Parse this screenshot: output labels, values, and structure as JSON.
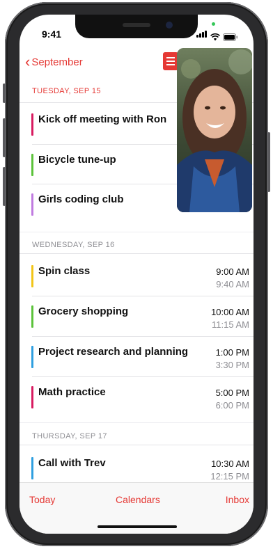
{
  "status_bar": {
    "time": "9:41"
  },
  "nav": {
    "back_label": "September"
  },
  "colors": {
    "accent": "#e53935",
    "section_today": "#e53935",
    "section_other": "#8e8e93"
  },
  "sections": [
    {
      "header": "TUESDAY, SEP 15",
      "events": [
        {
          "title": "Kick off meeting with Ron",
          "color": "#d81b60"
        },
        {
          "title": "Bicycle tune-up",
          "color": "#5cc33b"
        },
        {
          "title": "Girls coding club",
          "color": "#c07be0"
        }
      ]
    },
    {
      "header": "WEDNESDAY, SEP 16",
      "events": [
        {
          "title": "Spin class",
          "start": "9:00 AM",
          "end": "9:40 AM",
          "color": "#f2c518"
        },
        {
          "title": "Grocery shopping",
          "start": "10:00 AM",
          "end": "11:15 AM",
          "color": "#5cc33b"
        },
        {
          "title": "Project research and planning",
          "start": "1:00 PM",
          "end": "3:30 PM",
          "color": "#2f9fe0"
        },
        {
          "title": "Math practice",
          "start": "5:00 PM",
          "end": "6:00 PM",
          "color": "#d81b60"
        }
      ]
    },
    {
      "header": "THURSDAY, SEP 17",
      "events": [
        {
          "title": "Call with Trev",
          "start": "10:30 AM",
          "end": "12:15 PM",
          "color": "#2f9fe0"
        }
      ]
    }
  ],
  "tabbar": {
    "today": "Today",
    "calendars": "Calendars",
    "inbox": "Inbox"
  }
}
